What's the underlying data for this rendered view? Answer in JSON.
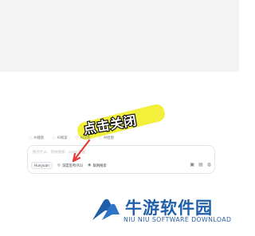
{
  "chips": [
    {
      "icon": "ai-search-icon",
      "glyph": "◌",
      "label": "AI搜索"
    },
    {
      "icon": "ai-read-icon",
      "glyph": "◌",
      "label": "AI阅读"
    },
    {
      "icon": "ai-write-icon",
      "glyph": "◌",
      "label": "AI写作"
    },
    {
      "icon": "ai-draw-icon",
      "glyph": "◌",
      "label": "AI绘图"
    }
  ],
  "banner": {
    "text": "点击关闭"
  },
  "composer": {
    "placeholder": "搜点什么，开始搜索，enter发送",
    "model": "Hunyuan",
    "deep_think": "深度思考(R1)",
    "web_search": "联网搜索"
  },
  "brand": {
    "name": "牛游软件园",
    "sub": "NIU NIU SOFTWARE DOWNLOAD"
  },
  "colors": {
    "highlight": "#f2ef2a",
    "brand_blue": "#1f5fa9",
    "top_band": "#f3f3f4"
  }
}
